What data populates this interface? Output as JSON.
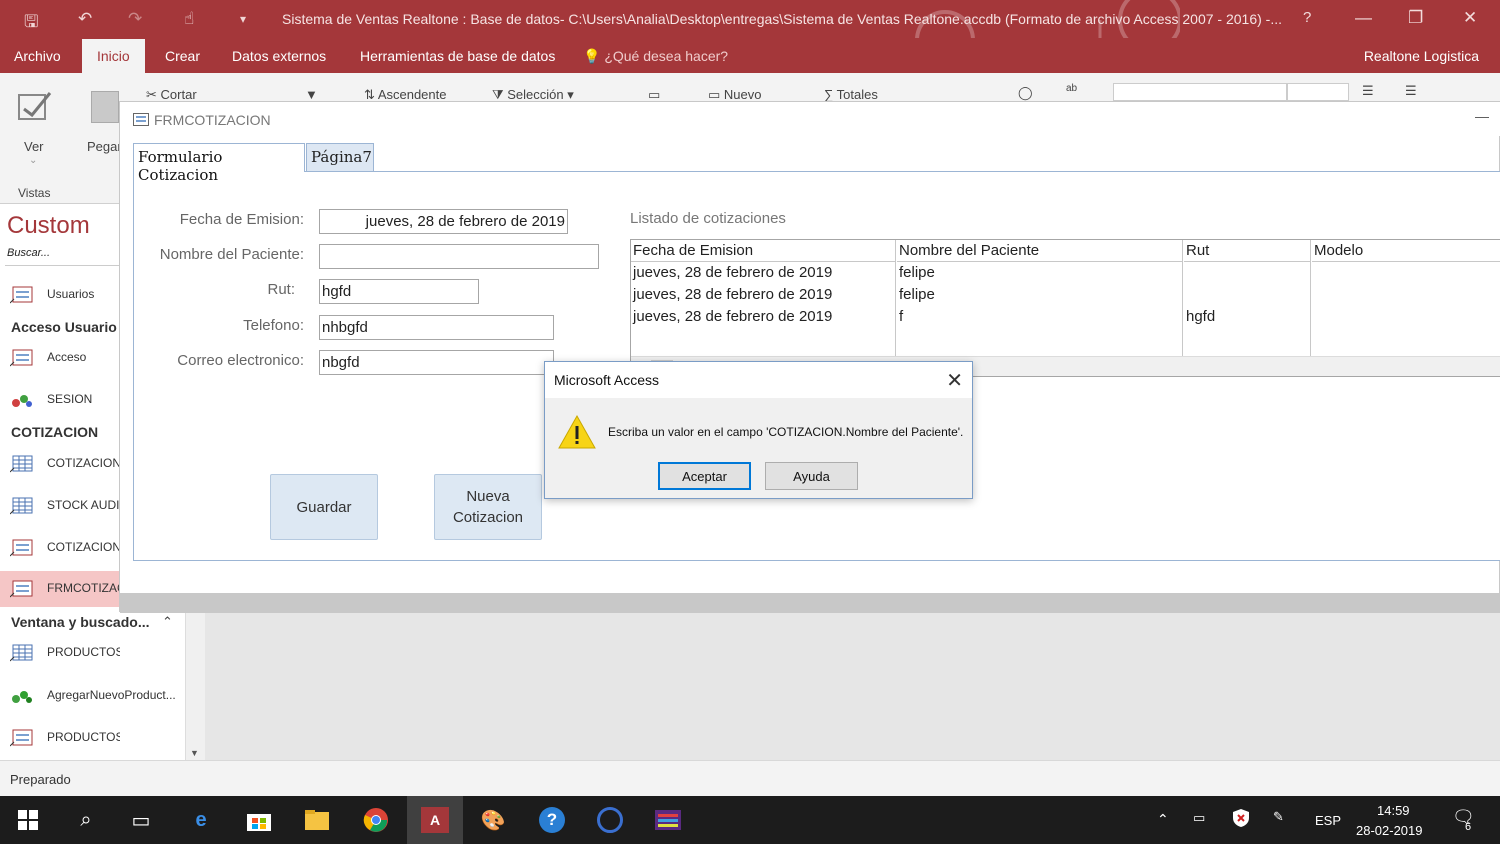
{
  "window": {
    "title": "Sistema de Ventas Realtone : Base de datos- C:\\Users\\Analia\\Desktop\\entregas\\Sistema de Ventas Realtone.accdb (Formato de archivo Access 2007 - 2016) -...",
    "help": "?",
    "minimize": "—",
    "restore": "❐",
    "close": "✕"
  },
  "menu": {
    "items": [
      "Archivo",
      "Inicio",
      "Crear",
      "Datos externos",
      "Herramientas de base de datos"
    ],
    "active": "Inicio",
    "tell_me": "¿Qué desea hacer?",
    "user": "Realtone Logistica"
  },
  "ribbon": {
    "view_label": "Ver",
    "paste_label": "Pegar",
    "cut_label": "Cortar",
    "ascending_label": "Ascendente",
    "selection_label": "Selección",
    "new_label": "Nuevo",
    "totals_label": "Totales",
    "group_views": "Vistas"
  },
  "navpane": {
    "title": "Custom",
    "search_placeholder": "Buscar...",
    "sections": [
      {
        "header": "",
        "items": [
          {
            "label": "Usuarios",
            "icon": "form-icon"
          }
        ]
      },
      {
        "header": "Acceso Usuario",
        "items": [
          {
            "label": "Acceso",
            "icon": "form-icon"
          },
          {
            "label": "SESION",
            "icon": "macro-icon"
          }
        ]
      },
      {
        "header": "COTIZACION",
        "items": [
          {
            "label": "COTIZACION",
            "icon": "table-icon"
          },
          {
            "label": "STOCK AUDIF",
            "icon": "table-icon"
          },
          {
            "label": "COTIZACION",
            "icon": "form-icon"
          },
          {
            "label": "FRMCOTIZAC",
            "icon": "form-icon"
          }
        ]
      },
      {
        "header": "Ventana y buscado...",
        "items": [
          {
            "label": "PRODUCTOS",
            "icon": "table-icon"
          },
          {
            "label": "AgregarNuevoProduct...",
            "icon": "macro-icon"
          },
          {
            "label": "PRODUCTOS",
            "icon": "form-icon"
          }
        ]
      }
    ],
    "collapse_glyph": "⌃"
  },
  "form": {
    "title": "FRMCOTIZACION",
    "tabs": [
      "Formulario Cotizacion",
      "Página7"
    ],
    "fields": {
      "fecha_label": "Fecha de Emision:",
      "fecha_value": "jueves, 28 de febrero de 2019",
      "nombre_label": "Nombre del Paciente:",
      "nombre_value": "",
      "rut_label": "Rut:",
      "rut_value": "hgfd",
      "telefono_label": "Telefono:",
      "telefono_value": "nhbgfd",
      "correo_label": "Correo electronico:",
      "correo_value": "nbgfd"
    },
    "buttons": {
      "guardar": "Guardar",
      "nueva_line1": "Nueva",
      "nueva_line2": "Cotizacion"
    },
    "list": {
      "label": "Listado de cotizaciones",
      "columns": [
        "Fecha de Emision",
        "Nombre del Paciente",
        "Rut",
        "Modelo"
      ],
      "rows": [
        [
          "jueves, 28 de febrero de 2019",
          "felipe",
          "",
          ""
        ],
        [
          "jueves, 28 de febrero de 2019",
          "felipe",
          "",
          ""
        ],
        [
          "jueves, 28 de febrero de 2019",
          "f",
          "hgfd",
          ""
        ]
      ]
    }
  },
  "dialog": {
    "title": "Microsoft Access",
    "message": "Escriba un valor en el campo 'COTIZACION.Nombre del Paciente'.",
    "ok": "Aceptar",
    "help": "Ayuda",
    "close": "✕",
    "icon": "warning-icon"
  },
  "status": {
    "text": "Preparado"
  },
  "taskbar": {
    "language": "ESP",
    "time": "14:59",
    "date": "28-02-2019",
    "notifications": "6"
  },
  "colors": {
    "accent": "#a4373a",
    "selected_nav": "#f5c6c6",
    "button_blue": "#dde8f3"
  }
}
